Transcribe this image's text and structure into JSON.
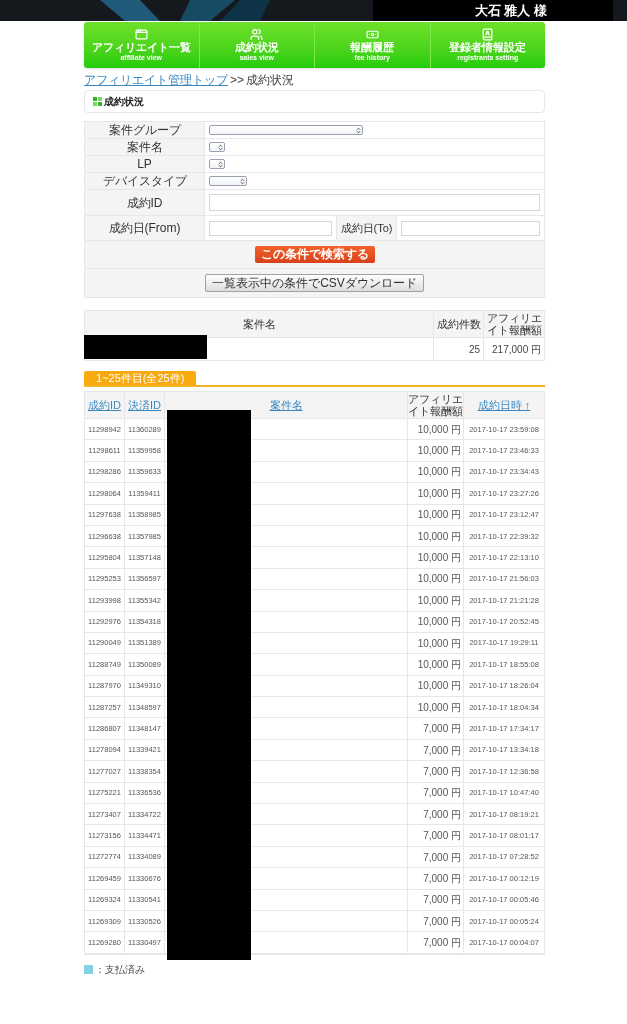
{
  "header": {
    "user_name": "大石 雅人 様"
  },
  "nav": [
    {
      "label": "アフィリエイト一覧",
      "sublabel": "affiliate view"
    },
    {
      "label": "成約状況",
      "sublabel": "sales view"
    },
    {
      "label": "報酬履歴",
      "sublabel": "fee history"
    },
    {
      "label": "登録者情報設定",
      "sublabel": "registrants setting"
    }
  ],
  "breadcrumb": {
    "link": "アフィリエイト管理トップ",
    "separator": ">>",
    "current": "成約状況"
  },
  "page_title": "成約状況",
  "search_form": {
    "fields": [
      {
        "label": "案件グループ",
        "kind": "select"
      },
      {
        "label": "案件名",
        "kind": "select"
      },
      {
        "label": "LP",
        "kind": "select"
      },
      {
        "label": "デバイスタイプ",
        "kind": "select"
      },
      {
        "label": "成約ID",
        "kind": "text"
      }
    ],
    "date_from_label": "成約日(From)",
    "date_to_label": "成約日(To)",
    "search_button": "この条件で検索する",
    "csv_button": "一覧表示中の条件でCSVダウンロード"
  },
  "summary": {
    "columns": [
      "案件名",
      "成約件数",
      "アフィリエイト報酬額"
    ],
    "count": "25",
    "amount": "217,000 円"
  },
  "results": {
    "tab": "1~25件目(全25件)",
    "columns": [
      {
        "label": "成約ID",
        "kind": "link"
      },
      {
        "label": "決済ID",
        "kind": "link"
      },
      {
        "label": "案件名",
        "kind": "link"
      },
      {
        "label": "アフィリエイト報酬額",
        "kind": "text"
      },
      {
        "label": "成約日時 ↑",
        "kind": "link"
      }
    ],
    "rows": [
      {
        "contract_id": "11298942",
        "payment_id": "11360289",
        "amount": "10,000 円",
        "datetime": "2017-10-17 23:59:08"
      },
      {
        "contract_id": "11298611",
        "payment_id": "11359958",
        "amount": "10,000 円",
        "datetime": "2017-10-17 23:46:33"
      },
      {
        "contract_id": "11298286",
        "payment_id": "11359633",
        "amount": "10,000 円",
        "datetime": "2017-10-17 23:34:43"
      },
      {
        "contract_id": "11298064",
        "payment_id": "11359411",
        "amount": "10,000 円",
        "datetime": "2017-10-17 23:27:26"
      },
      {
        "contract_id": "11297638",
        "payment_id": "11358985",
        "amount": "10,000 円",
        "datetime": "2017-10-17 23:12:47"
      },
      {
        "contract_id": "11296638",
        "payment_id": "11357985",
        "amount": "10,000 円",
        "datetime": "2017-10-17 22:39:32"
      },
      {
        "contract_id": "11295804",
        "payment_id": "11357148",
        "amount": "10,000 円",
        "datetime": "2017-10-17 22:13:10"
      },
      {
        "contract_id": "11295253",
        "payment_id": "11356597",
        "amount": "10,000 円",
        "datetime": "2017-10-17 21:56:03"
      },
      {
        "contract_id": "11293998",
        "payment_id": "11355342",
        "amount": "10,000 円",
        "datetime": "2017-10-17 21:21:28"
      },
      {
        "contract_id": "11292976",
        "payment_id": "11354318",
        "amount": "10,000 円",
        "datetime": "2017-10-17 20:52:45"
      },
      {
        "contract_id": "11290049",
        "payment_id": "11351389",
        "amount": "10,000 円",
        "datetime": "2017-10-17 19:29:11"
      },
      {
        "contract_id": "11288749",
        "payment_id": "11350089",
        "amount": "10,000 円",
        "datetime": "2017-10-17 18:55:08"
      },
      {
        "contract_id": "11287970",
        "payment_id": "11349310",
        "amount": "10,000 円",
        "datetime": "2017-10-17 18:26:04"
      },
      {
        "contract_id": "11287257",
        "payment_id": "11348597",
        "amount": "10,000 円",
        "datetime": "2017-10-17 18:04:34"
      },
      {
        "contract_id": "11286807",
        "payment_id": "11348147",
        "amount": "7,000 円",
        "datetime": "2017-10-17 17:34:17"
      },
      {
        "contract_id": "11278094",
        "payment_id": "11339421",
        "amount": "7,000 円",
        "datetime": "2017-10-17 13:34:18"
      },
      {
        "contract_id": "11277027",
        "payment_id": "11338354",
        "amount": "7,000 円",
        "datetime": "2017-10-17 12:36:58"
      },
      {
        "contract_id": "11275221",
        "payment_id": "11336536",
        "amount": "7,000 円",
        "datetime": "2017-10-17 10:47:40"
      },
      {
        "contract_id": "11273407",
        "payment_id": "11334722",
        "amount": "7,000 円",
        "datetime": "2017-10-17 08:19:21"
      },
      {
        "contract_id": "11273156",
        "payment_id": "11334471",
        "amount": "7,000 円",
        "datetime": "2017-10-17 08:01:17"
      },
      {
        "contract_id": "11272774",
        "payment_id": "11334089",
        "amount": "7,000 円",
        "datetime": "2017-10-17 07:28:52"
      },
      {
        "contract_id": "11269459",
        "payment_id": "11330676",
        "amount": "7,000 円",
        "datetime": "2017-10-17 00:12:19"
      },
      {
        "contract_id": "11269324",
        "payment_id": "11330541",
        "amount": "7,000 円",
        "datetime": "2017-10-17 00:05:46"
      },
      {
        "contract_id": "11269309",
        "payment_id": "11330526",
        "amount": "7,000 円",
        "datetime": "2017-10-17 00:05:24"
      },
      {
        "contract_id": "11269280",
        "payment_id": "11330497",
        "amount": "7,000 円",
        "datetime": "2017-10-17 00:04:07"
      }
    ]
  },
  "legend": {
    "color": "#86d0e3",
    "label": "：支払済み"
  }
}
